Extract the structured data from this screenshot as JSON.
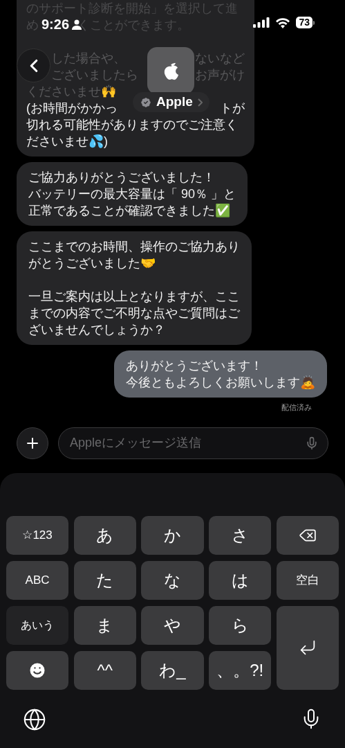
{
  "status_bar": {
    "time": "9:26",
    "battery": "73"
  },
  "header": {
    "contact_name": "Apple",
    "verified": true
  },
  "messages": [
    {
      "kind": "received",
      "paragraphs": [
        [
          {
            "kind": "gap",
            "segments": [
              "のサポート診断を開始」を選択して進"
            ]
          },
          {
            "kind": "gap",
            "segments": [
              "め",
              "くことができます。"
            ]
          }
        ],
        [
          {
            "kind": "covered_split",
            "segments": [
              "した場合や、",
              "ないなど"
            ]
          },
          {
            "kind": "covered_split",
            "segments": [
              "ございましたら",
              "お声がけ"
            ]
          },
          {
            "kind": "gap",
            "segments": [
              "くださいませ🙌"
            ]
          },
          {
            "kind": "split",
            "segments": [
              "(お時間がかかっ",
              "トが"
            ]
          },
          {
            "kind": "gap",
            "segments": [
              "切れる可能性がありますのでご注意く"
            ]
          },
          {
            "kind": "gap",
            "segments": [
              "ださいませ💦)"
            ]
          }
        ]
      ]
    },
    {
      "kind": "received",
      "paragraphs": [
        [
          {
            "kind": "gap",
            "segments": [
              "ご協力ありがとうございました！"
            ]
          },
          {
            "kind": "gap",
            "segments": [
              "バッテリーの最大容量は「 90％ 」と"
            ]
          },
          {
            "kind": "gap",
            "segments": [
              "正常であることが確認できました✅"
            ]
          }
        ]
      ]
    },
    {
      "kind": "received",
      "paragraphs": [
        [
          {
            "kind": "gap",
            "segments": [
              "ここまでのお時間、操作のご協力あり"
            ]
          },
          {
            "kind": "gap",
            "segments": [
              "がとうございました🤝"
            ]
          }
        ],
        [
          {
            "kind": "gap",
            "segments": [
              "一旦ご案内は以上となりますが、ここ"
            ]
          },
          {
            "kind": "gap",
            "segments": [
              "までの内容でご不明な点やご質問はご"
            ]
          },
          {
            "kind": "gap",
            "segments": [
              "ざいませんでしょうか？"
            ]
          }
        ]
      ]
    },
    {
      "kind": "sent",
      "paragraphs": [
        [
          {
            "kind": "gap",
            "segments": [
              "ありがとうございます！"
            ]
          },
          {
            "kind": "gap",
            "segments": [
              "今後ともよろしくお願いします🙇"
            ]
          }
        ]
      ],
      "status": "配信済み"
    }
  ],
  "composer": {
    "placeholder": "Appleにメッセージ送信"
  },
  "keyboard": {
    "keys": [
      {
        "kind": "function",
        "label": "☆123"
      },
      {
        "kind": "char",
        "label": "あ"
      },
      {
        "kind": "char",
        "label": "か"
      },
      {
        "kind": "char",
        "label": "さ"
      },
      {
        "kind": "backspace"
      },
      {
        "kind": "function",
        "label": "ABC"
      },
      {
        "kind": "char",
        "label": "た"
      },
      {
        "kind": "char",
        "label": "な"
      },
      {
        "kind": "char",
        "label": "は"
      },
      {
        "kind": "function",
        "label": "空白"
      },
      {
        "kind": "mode",
        "label": "あいう"
      },
      {
        "kind": "char",
        "label": "ま"
      },
      {
        "kind": "char",
        "label": "や"
      },
      {
        "kind": "char",
        "label": "ら"
      },
      {
        "kind": "return"
      },
      {
        "kind": "emoji"
      },
      {
        "kind": "char",
        "label": "^^"
      },
      {
        "kind": "char",
        "label": "わ_"
      },
      {
        "kind": "char",
        "label": "、。?!"
      }
    ]
  }
}
